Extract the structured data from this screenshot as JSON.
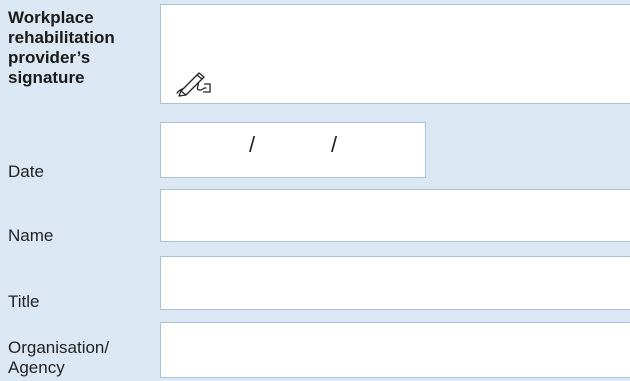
{
  "fields": {
    "signature": {
      "label_lines": [
        "Workplace",
        "rehabilitation",
        "provider’s",
        "signature"
      ],
      "icon": "signature-pen-icon"
    },
    "date": {
      "label": "Date",
      "separator_1": "/",
      "separator_2": "/"
    },
    "name": {
      "label": "Name"
    },
    "title": {
      "label": "Title"
    },
    "organisation": {
      "label_lines": [
        "Organisation/",
        "Agency"
      ]
    }
  },
  "colors": {
    "background": "#dbe8f4",
    "field_background": "#ffffff",
    "field_border": "#a9c3dc"
  }
}
